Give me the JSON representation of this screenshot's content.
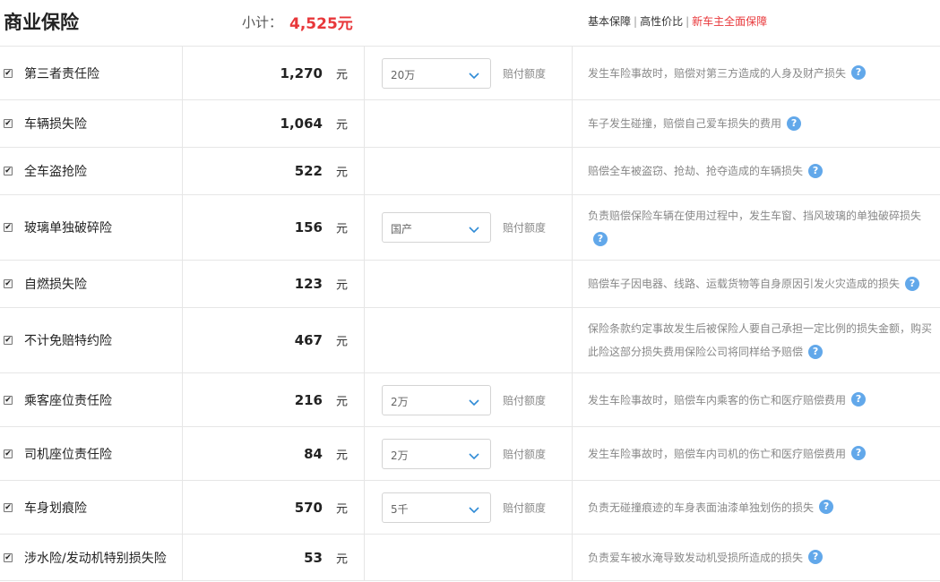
{
  "header": {
    "title": "商业保险",
    "subtotal_label": "小计：",
    "subtotal_value": "4,525元",
    "plans": [
      "基本保障",
      "高性价比",
      "新车主全面保障"
    ]
  },
  "currency_unit": "元",
  "limit_label": "赔付额度",
  "checkbox_glyph": "✔",
  "help_glyph": "?",
  "rows": [
    {
      "name": "第三者责任险",
      "price": "1,270",
      "unit": "元",
      "limit": "20万",
      "limit_label": "赔付额度",
      "desc": "发生车险事故时，赔偿对第三方造成的人身及财产损失",
      "checked": true
    },
    {
      "name": "车辆损失险",
      "price": "1,064",
      "unit": "元",
      "desc": "车子发生碰撞，赔偿自己爱车损失的费用",
      "checked": true
    },
    {
      "name": "全车盗抢险",
      "price": "522",
      "unit": "元",
      "desc": "赔偿全车被盗窃、抢劫、抢夺造成的车辆损失",
      "checked": true
    },
    {
      "name": "玻璃单独破碎险",
      "price": "156",
      "unit": "元",
      "limit": "国产",
      "limit_label": "赔付额度",
      "desc": "负责赔偿保险车辆在使用过程中，发生车窗、挡风玻璃的单独破碎损失",
      "checked": true
    },
    {
      "name": "自燃损失险",
      "price": "123",
      "unit": "元",
      "desc": "赔偿车子因电器、线路、运载货物等自身原因引发火灾造成的损失",
      "checked": true
    },
    {
      "name": "不计免赔特约险",
      "price": "467",
      "unit": "元",
      "desc": "保险条款约定事故发生后被保险人要自己承担一定比例的损失金额，购买此险这部分损失费用保险公司将同样给予赔偿",
      "checked": true
    },
    {
      "name": "乘客座位责任险",
      "price": "216",
      "unit": "元",
      "limit": "2万",
      "limit_label": "赔付额度",
      "desc": "发生车险事故时，赔偿车内乘客的伤亡和医疗赔偿费用",
      "checked": true
    },
    {
      "name": "司机座位责任险",
      "price": "84",
      "unit": "元",
      "limit": "2万",
      "limit_label": "赔付额度",
      "desc": "发生车险事故时，赔偿车内司机的伤亡和医疗赔偿费用",
      "checked": true
    },
    {
      "name": "车身划痕险",
      "price": "570",
      "unit": "元",
      "limit": "5千",
      "limit_label": "赔付额度",
      "desc": "负责无碰撞痕迹的车身表面油漆单独划伤的损失",
      "checked": true
    },
    {
      "name": "涉水险/发动机特别损失险",
      "price": "53",
      "unit": "元",
      "desc": "负责爱车被水淹导致发动机受损所造成的损失",
      "checked": true
    }
  ],
  "colors": {
    "accent_red": "#e8373a",
    "help_blue": "#62a8ea",
    "border": "#e6e6e6"
  }
}
